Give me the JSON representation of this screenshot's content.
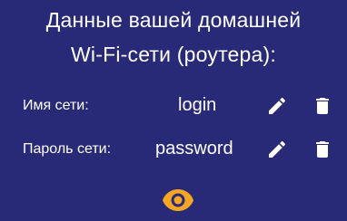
{
  "header": {
    "line1": "Данные вашей домашней",
    "line2": "Wi-Fi-сети (роутера):"
  },
  "fields": [
    {
      "label": "Имя сети:",
      "value": "login"
    },
    {
      "label": "Пароль сети:",
      "value": "password"
    }
  ],
  "icons": {
    "edit": "pencil-icon",
    "delete": "trash-icon",
    "toggle_visibility": "eye-icon"
  },
  "colors": {
    "background": "#282A77",
    "text": "#FFFFFF",
    "accent": "#F5A623"
  }
}
